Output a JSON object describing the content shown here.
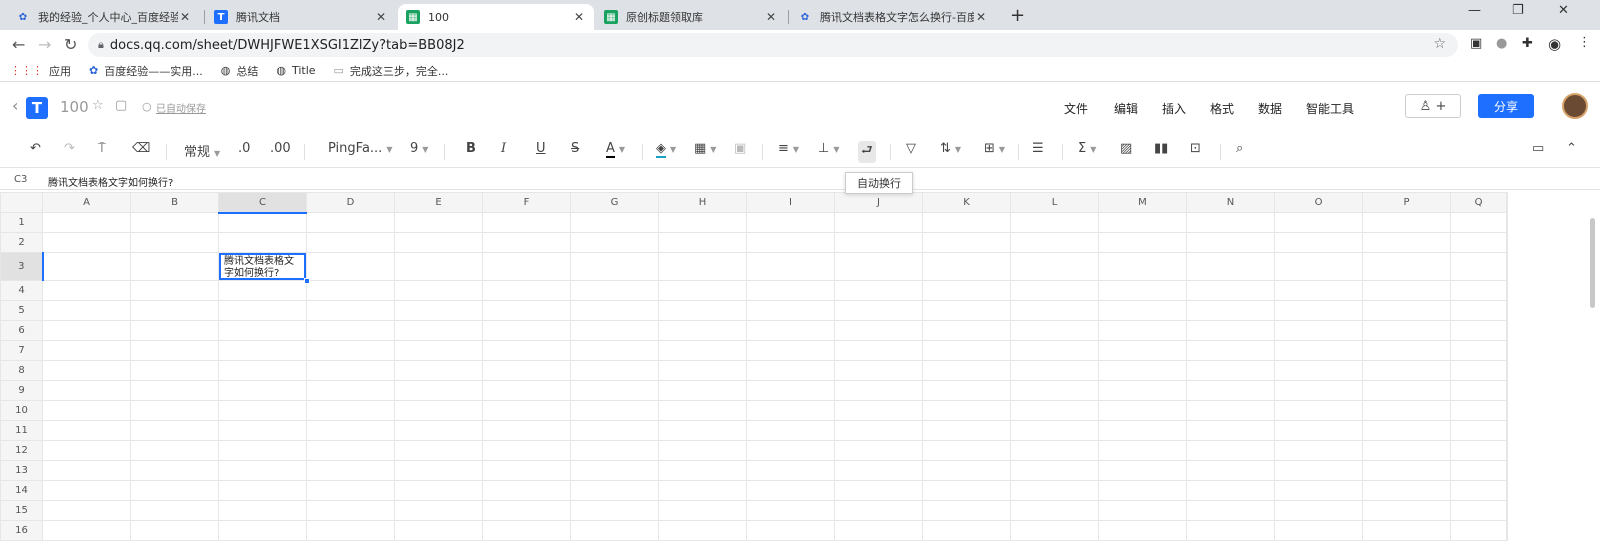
{
  "browser": {
    "tabs": [
      {
        "title": "我的经验_个人中心_百度经验",
        "icon": "baidu-paw-icon"
      },
      {
        "title": "腾讯文档",
        "icon": "tencent-docs-icon"
      },
      {
        "title": "100",
        "icon": "sheet-icon"
      },
      {
        "title": "原创标题领取库",
        "icon": "sheet-icon"
      },
      {
        "title": "腾讯文档表格文字怎么换行-百度",
        "icon": "baidu-paw-icon"
      }
    ],
    "url": "docs.qq.com/sheet/DWHJFWE1XSGI1ZlZy?tab=BB08J2",
    "bookmarks": [
      {
        "label": "应用",
        "icon": "apps-grid-icon"
      },
      {
        "label": "百度经验——实用...",
        "icon": "baidu-paw-icon"
      },
      {
        "label": "总结",
        "icon": "globe-icon"
      },
      {
        "label": "Title",
        "icon": "globe-icon"
      },
      {
        "label": "完成这三步，完全...",
        "icon": "page-icon"
      }
    ]
  },
  "doc": {
    "title": "100",
    "save_status": "已自动保存",
    "menu": [
      "文件",
      "编辑",
      "插入",
      "格式",
      "数据",
      "智能工具"
    ],
    "share_label": "分享"
  },
  "toolbar": {
    "number_format": "常规",
    "decrease_decimal": ".0",
    "increase_decimal": ".00",
    "font": "PingFa...",
    "font_size": "9"
  },
  "formula_bar": {
    "cell_ref": "C3",
    "content": "腾讯文档表格文字如何换行?"
  },
  "tooltip": "自动换行",
  "sheet": {
    "columns": [
      "A",
      "B",
      "C",
      "D",
      "E",
      "F",
      "G",
      "H",
      "I",
      "J",
      "K",
      "L",
      "M",
      "N",
      "O",
      "P",
      "Q"
    ],
    "rows": [
      "1",
      "2",
      "3",
      "4",
      "5",
      "6",
      "7",
      "8",
      "9",
      "10",
      "11",
      "12",
      "13",
      "14",
      "15",
      "16"
    ],
    "active_cell_text": "腾讯文档表格文字如何换行?",
    "selected_column": "C",
    "selected_row": "3"
  },
  "colors": {
    "accent": "#1e6fff"
  }
}
